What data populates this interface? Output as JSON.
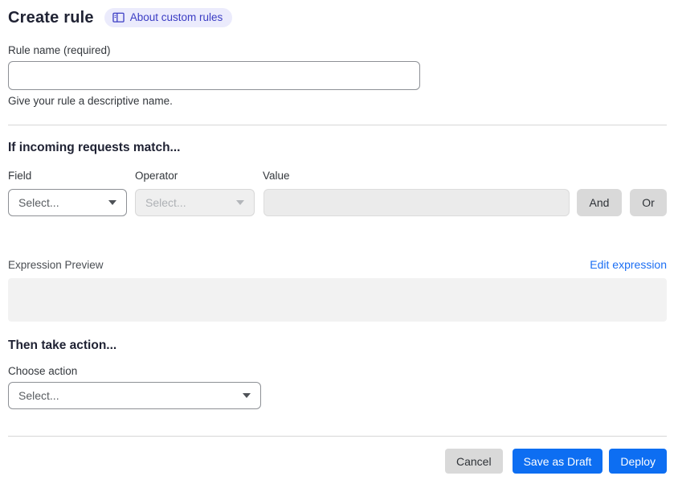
{
  "header": {
    "title": "Create rule",
    "about_link": "About custom rules"
  },
  "rule_name": {
    "label": "Rule name (required)",
    "value": "",
    "helper": "Give your rule a descriptive name."
  },
  "match_section": {
    "heading": "If incoming requests match...",
    "field_label": "Field",
    "operator_label": "Operator",
    "value_label": "Value",
    "field_placeholder": "Select...",
    "operator_placeholder": "Select...",
    "value_value": "",
    "and_button": "And",
    "or_button": "Or",
    "expression_preview_label": "Expression Preview",
    "edit_expression_link": "Edit expression",
    "expression_value": ""
  },
  "action_section": {
    "heading": "Then take action...",
    "choose_action_label": "Choose action",
    "action_placeholder": "Select..."
  },
  "footer": {
    "cancel": "Cancel",
    "save_draft": "Save as Draft",
    "deploy": "Deploy"
  },
  "colors": {
    "primary_blue": "#0d6ef2",
    "link_blue": "#1b6ef3",
    "badge_bg": "#ebebfc",
    "badge_text": "#3b3dc4",
    "heading_text": "#1f2233",
    "gray_button": "#d9d9d9",
    "disabled_bg": "#efefef",
    "preview_bg": "#f2f2f2",
    "divider": "#d6d6d6"
  }
}
